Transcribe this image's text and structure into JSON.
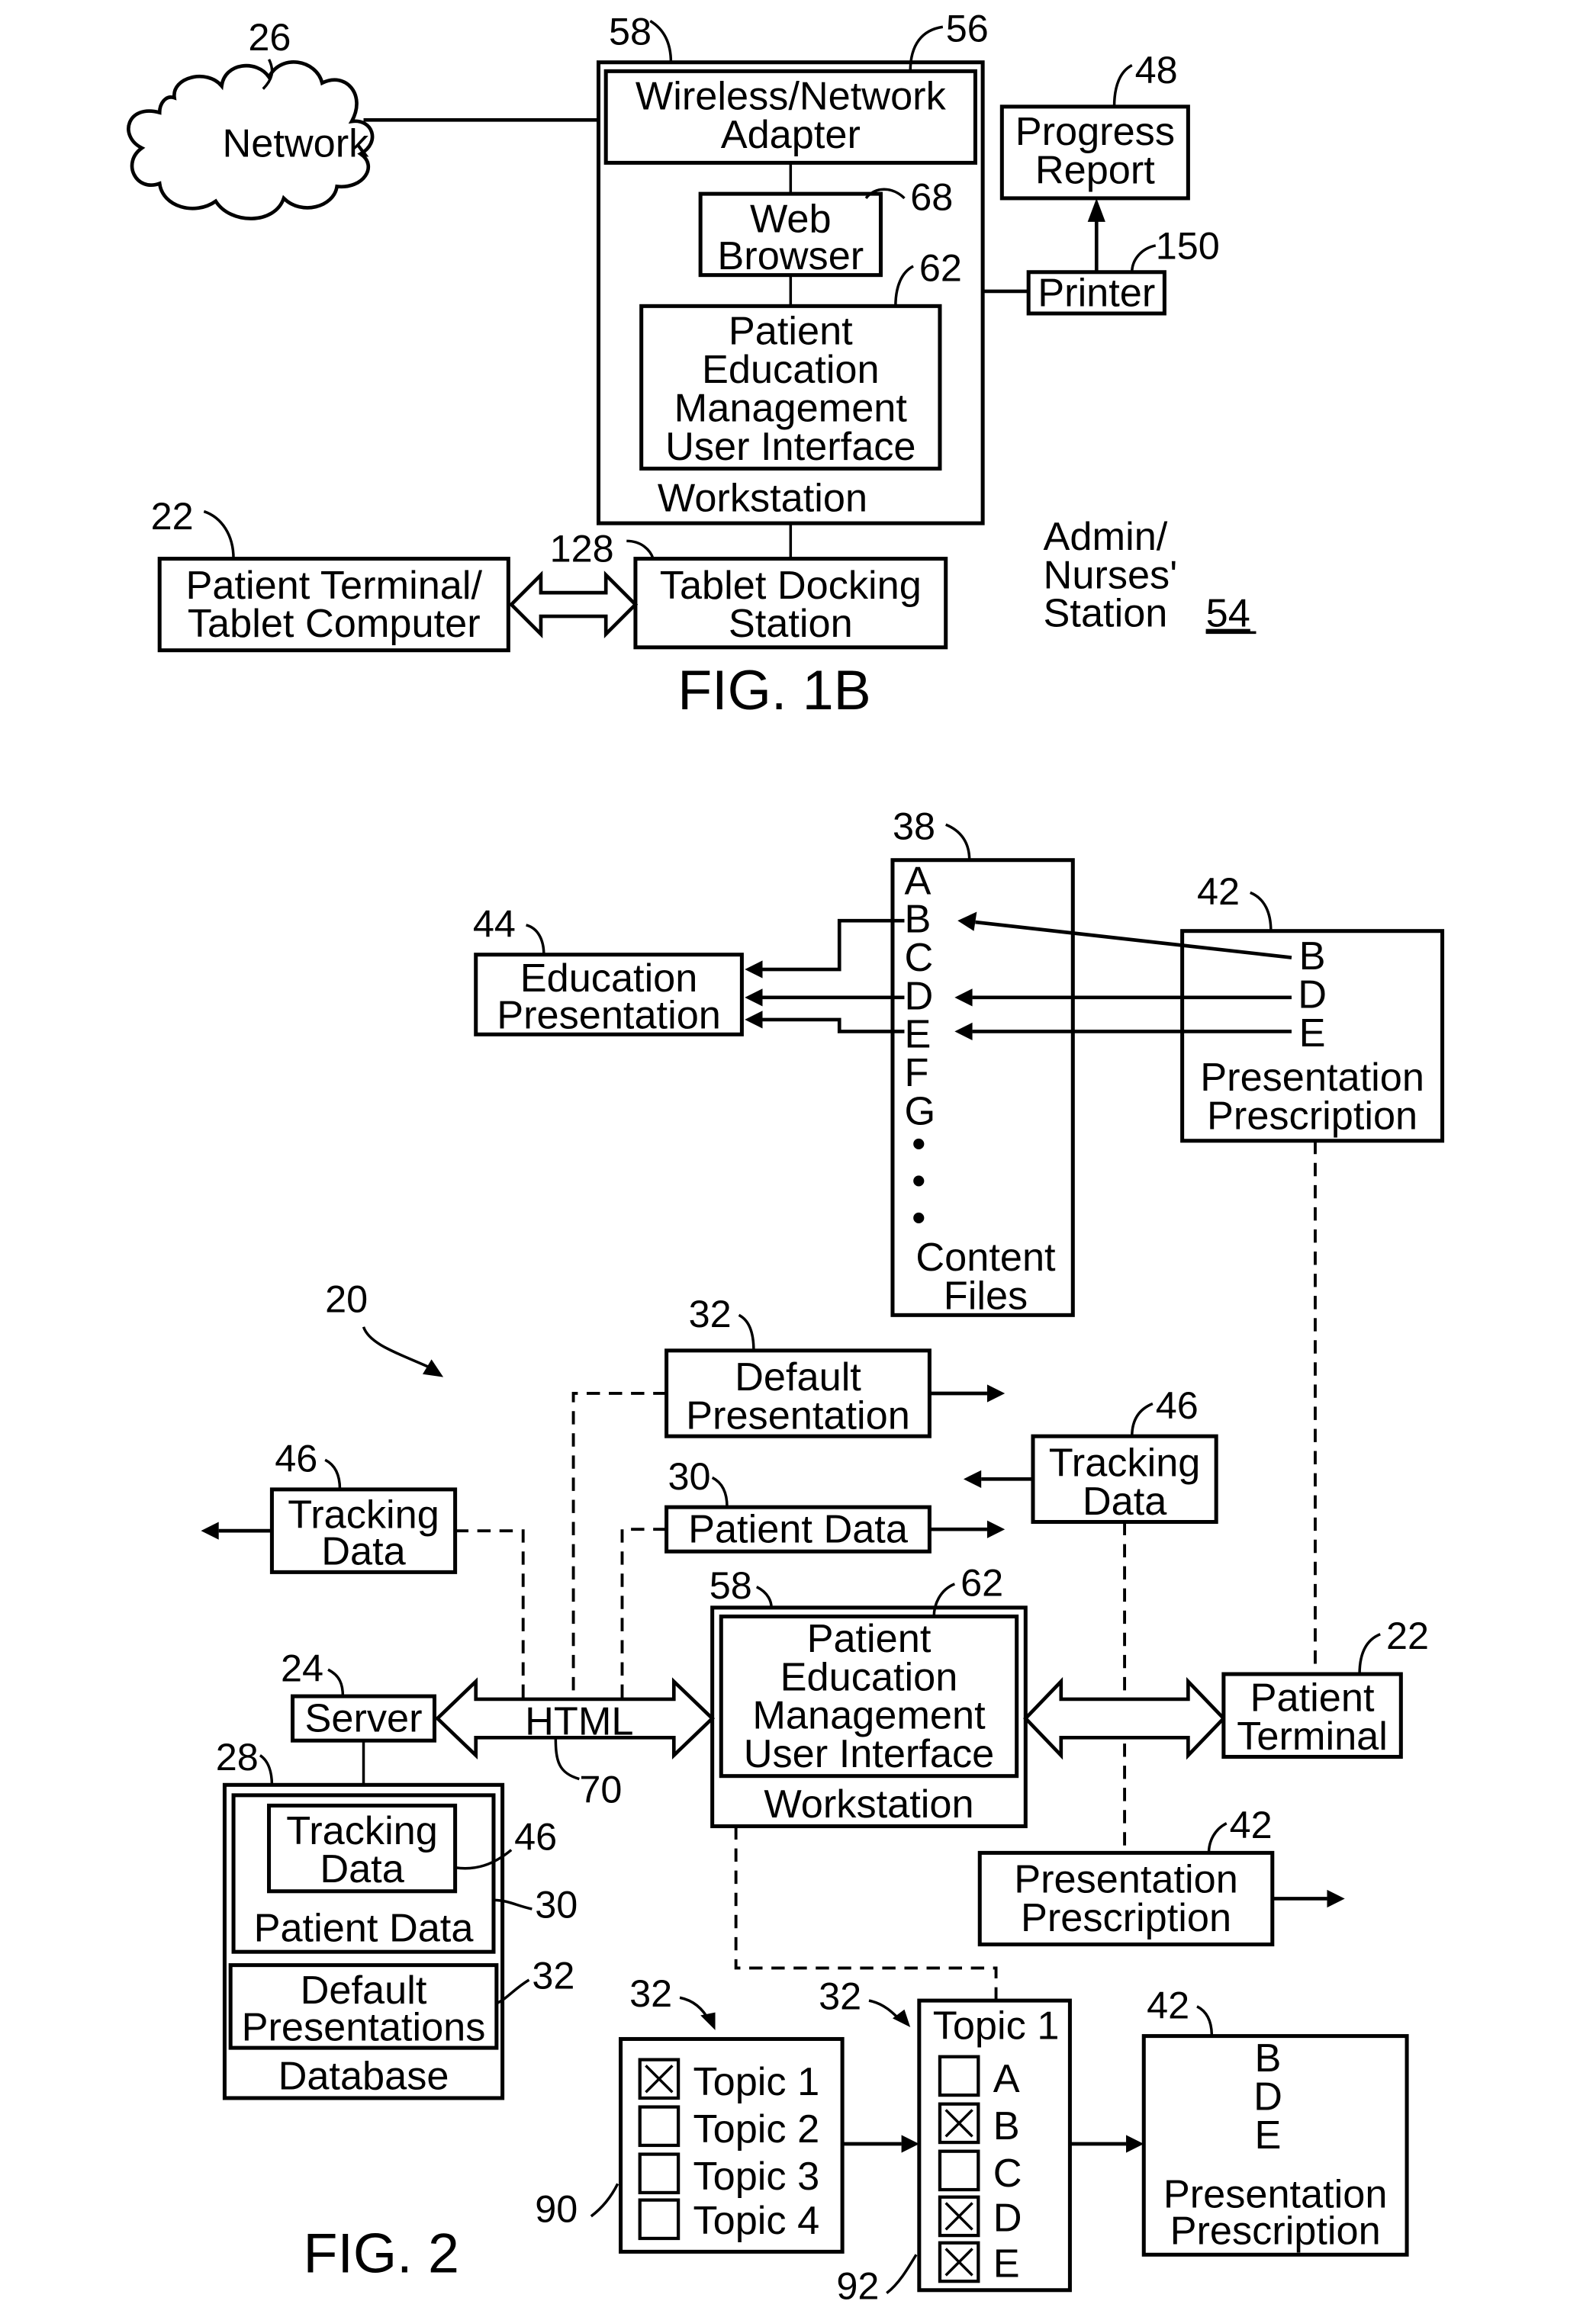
{
  "fig1b": {
    "title": "FIG. 1B",
    "network": {
      "label": "Network",
      "ref": "26"
    },
    "workstation": {
      "label": "Workstation",
      "ref": "58",
      "container_ref": "56"
    },
    "adapter": {
      "line1": "Wireless/Network",
      "line2": "Adapter"
    },
    "browser": {
      "line1": "Web",
      "line2": "Browser",
      "ref": "68"
    },
    "pem_ui": {
      "line1": "Patient",
      "line2": "Education",
      "line3": "Management",
      "line4": "User Interface",
      "ref": "62"
    },
    "progress_report": {
      "line1": "Progress",
      "line2": "Report",
      "ref": "48"
    },
    "printer": {
      "label": "Printer",
      "ref": "150"
    },
    "patient_terminal": {
      "line1": "Patient Terminal/",
      "line2": "Tablet Computer",
      "ref": "22"
    },
    "docking": {
      "line1": "Tablet Docking",
      "line2": "Station",
      "ref": "128"
    },
    "station": {
      "line1": "Admin/",
      "line2": "Nurses'",
      "line3": "Station",
      "ref": "54"
    }
  },
  "fig2": {
    "title": "FIG. 2",
    "system_ref": "20",
    "content_files": {
      "ref": "38",
      "letters": [
        "A",
        "B",
        "C",
        "D",
        "E",
        "F",
        "G"
      ],
      "ellipsis": [
        "•",
        "•",
        "•"
      ],
      "line1": "Content",
      "line2": "Files"
    },
    "education_presentation": {
      "line1": "Education",
      "line2": "Presentation",
      "ref": "44"
    },
    "prescription_top": {
      "letters": [
        "B",
        "D",
        "E"
      ],
      "line1": "Presentation",
      "line2": "Prescription",
      "ref": "42"
    },
    "default_presentation": {
      "line1": "Default",
      "line2": "Presentation",
      "ref": "32"
    },
    "tracking_right": {
      "line1": "Tracking",
      "line2": "Data",
      "ref": "46"
    },
    "tracking_left": {
      "line1": "Tracking",
      "line2": "Data",
      "ref": "46"
    },
    "patient_data": {
      "label": "Patient Data",
      "ref": "30"
    },
    "workstation": {
      "label": "Workstation",
      "ref": "58"
    },
    "pem_ui": {
      "line1": "Patient",
      "line2": "Education",
      "line3": "Management",
      "line4": "User Interface",
      "ref": "62"
    },
    "server": {
      "label": "Server",
      "ref": "24"
    },
    "html_link": {
      "label": "HTML",
      "ref": "70"
    },
    "patient_terminal": {
      "line1": "Patient",
      "line2": "Terminal",
      "ref": "22"
    },
    "database": {
      "label": "Database",
      "ref": "28",
      "tracking": {
        "line1": "Tracking",
        "line2": "Data",
        "ref": "46"
      },
      "patient_data": {
        "label": "Patient Data",
        "ref": "30"
      },
      "defaults": {
        "line1": "Default",
        "line2": "Presentations",
        "ref": "32"
      }
    },
    "prescription_mid": {
      "line1": "Presentation",
      "line2": "Prescription",
      "ref": "42"
    },
    "topic_list": {
      "ref_arrow": "32",
      "ref": "90",
      "items": [
        {
          "label": "Topic 1",
          "checked": true
        },
        {
          "label": "Topic 2",
          "checked": false
        },
        {
          "label": "Topic 3",
          "checked": false
        },
        {
          "label": "Topic 4",
          "checked": false
        }
      ]
    },
    "topic1_detail": {
      "title": "Topic 1",
      "ref_arrow": "32",
      "ref": "92",
      "items": [
        {
          "label": "A",
          "checked": false
        },
        {
          "label": "B",
          "checked": true
        },
        {
          "label": "C",
          "checked": false
        },
        {
          "label": "D",
          "checked": true
        },
        {
          "label": "E",
          "checked": true
        }
      ]
    },
    "prescription_bottom": {
      "letters": [
        "B",
        "D",
        "E"
      ],
      "line1": "Presentation",
      "line2": "Prescription",
      "ref": "42"
    }
  }
}
